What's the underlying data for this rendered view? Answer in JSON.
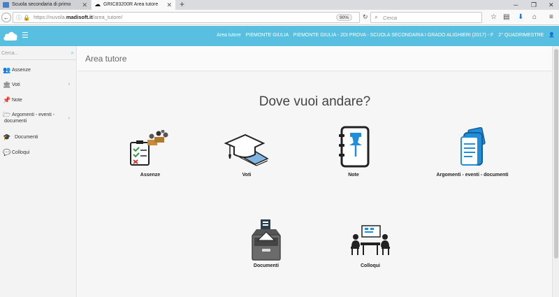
{
  "browser": {
    "tabs": [
      {
        "title": "Scuola secondaria di primo",
        "active": false
      },
      {
        "title": "GRIC83200R Area tutore",
        "active": true
      }
    ],
    "new_tab": "+",
    "url": {
      "prefix": "https://nuvola.",
      "domain": "madisoft.it",
      "path": "/area_tutore/"
    },
    "zoom": "90%",
    "search_placeholder": "Cerca"
  },
  "header": {
    "area": "Area tutore",
    "student": "PIEMONTE GIULIA",
    "class_info": "PIEMONTE GIULIA - 2DI PROVA - SCUOLA SECONDARIA I GRADO ALIGHIERI (2017) - F",
    "period": "2° QUADRIMESTRE",
    "accent_color": "#58bfe0"
  },
  "sidebar": {
    "search_placeholder": "Cerca...",
    "items": [
      {
        "label": "Assenze",
        "icon": "users-icon"
      },
      {
        "label": "Voti",
        "icon": "institution-icon"
      },
      {
        "label": "Note",
        "icon": "pin-icon"
      },
      {
        "label": "Argomenti - eventi - documenti",
        "label_line1": "Argomenti - eventi -",
        "label_line2": "documenti",
        "icon": "folder-open-icon"
      },
      {
        "label": "Documenti",
        "icon": "graduation-cap-icon"
      },
      {
        "label": "Colloqui",
        "icon": "chat-icon"
      }
    ]
  },
  "main": {
    "page_title": "Area tutore",
    "heading": "Dove vuoi andare?",
    "tiles": [
      {
        "label": "Assenze",
        "icon": "attendance-icon"
      },
      {
        "label": "Voti",
        "icon": "graduation-cap-icon"
      },
      {
        "label": "Note",
        "icon": "notebook-pin-icon"
      },
      {
        "label": "Argomenti - eventi - documenti",
        "icon": "documents-stack-icon"
      },
      {
        "label": "Documenti",
        "icon": "file-cabinet-icon"
      },
      {
        "label": "Colloqui",
        "icon": "meeting-icon"
      }
    ]
  }
}
